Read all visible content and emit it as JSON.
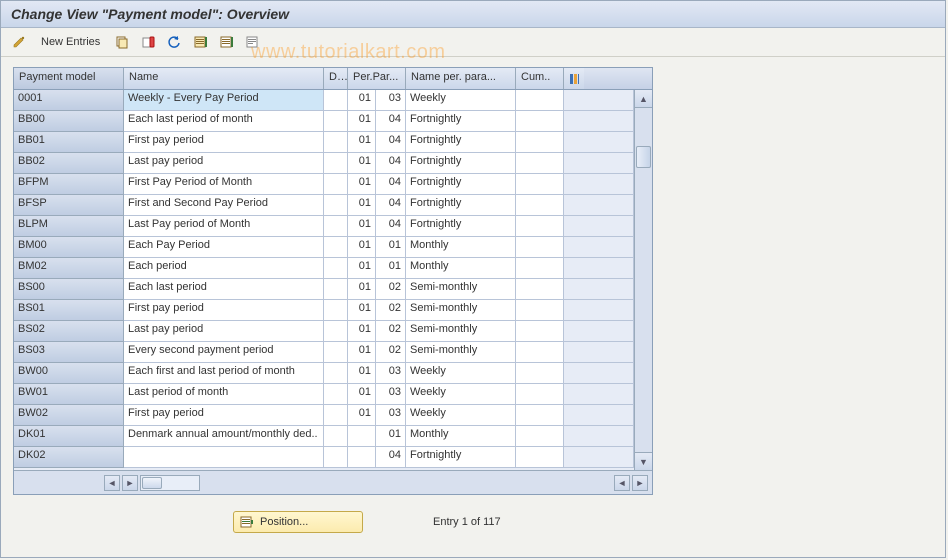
{
  "title": "Change View \"Payment model\": Overview",
  "toolbar": {
    "new_entries": "New Entries"
  },
  "watermark": "www.tutorialkart.com",
  "columns": {
    "c0": "Payment model",
    "c1": "Name",
    "c2": "D..",
    "c3": "Per.Par...",
    "c4": "Name per. para...",
    "c5": "Cum.."
  },
  "rows": [
    {
      "model": "0001",
      "name": "Weekly - Every Pay Period",
      "d": "",
      "pp": "01",
      "ppn": "03",
      "pname": "Weekly",
      "cum": "",
      "sel": true
    },
    {
      "model": "BB00",
      "name": "Each last period of month",
      "d": "",
      "pp": "01",
      "ppn": "04",
      "pname": "Fortnightly",
      "cum": ""
    },
    {
      "model": "BB01",
      "name": "First pay period",
      "d": "",
      "pp": "01",
      "ppn": "04",
      "pname": "Fortnightly",
      "cum": ""
    },
    {
      "model": "BB02",
      "name": "Last pay period",
      "d": "",
      "pp": "01",
      "ppn": "04",
      "pname": "Fortnightly",
      "cum": ""
    },
    {
      "model": "BFPM",
      "name": "First Pay Period of Month",
      "d": "",
      "pp": "01",
      "ppn": "04",
      "pname": "Fortnightly",
      "cum": ""
    },
    {
      "model": "BFSP",
      "name": "First and Second Pay Period",
      "d": "",
      "pp": "01",
      "ppn": "04",
      "pname": "Fortnightly",
      "cum": ""
    },
    {
      "model": "BLPM",
      "name": "Last Pay period of Month",
      "d": "",
      "pp": "01",
      "ppn": "04",
      "pname": "Fortnightly",
      "cum": ""
    },
    {
      "model": "BM00",
      "name": "Each Pay Period",
      "d": "",
      "pp": "01",
      "ppn": "01",
      "pname": "Monthly",
      "cum": ""
    },
    {
      "model": "BM02",
      "name": "Each period",
      "d": "",
      "pp": "01",
      "ppn": "01",
      "pname": "Monthly",
      "cum": ""
    },
    {
      "model": "BS00",
      "name": "Each last period",
      "d": "",
      "pp": "01",
      "ppn": "02",
      "pname": "Semi-monthly",
      "cum": ""
    },
    {
      "model": "BS01",
      "name": "First pay period",
      "d": "",
      "pp": "01",
      "ppn": "02",
      "pname": "Semi-monthly",
      "cum": ""
    },
    {
      "model": "BS02",
      "name": "Last pay period",
      "d": "",
      "pp": "01",
      "ppn": "02",
      "pname": "Semi-monthly",
      "cum": ""
    },
    {
      "model": "BS03",
      "name": "Every second payment period",
      "d": "",
      "pp": "01",
      "ppn": "02",
      "pname": "Semi-monthly",
      "cum": ""
    },
    {
      "model": "BW00",
      "name": "Each first and last period of month",
      "d": "",
      "pp": "01",
      "ppn": "03",
      "pname": "Weekly",
      "cum": ""
    },
    {
      "model": "BW01",
      "name": "Last period of month",
      "d": "",
      "pp": "01",
      "ppn": "03",
      "pname": "Weekly",
      "cum": ""
    },
    {
      "model": "BW02",
      "name": "First pay period",
      "d": "",
      "pp": "01",
      "ppn": "03",
      "pname": "Weekly",
      "cum": ""
    },
    {
      "model": "DK01",
      "name": "Denmark annual amount/monthly ded..",
      "d": "",
      "pp": "",
      "ppn": "01",
      "pname": "Monthly",
      "cum": ""
    },
    {
      "model": "DK02",
      "name": "",
      "d": "",
      "pp": "",
      "ppn": "04",
      "pname": "Fortnightly",
      "cum": ""
    }
  ],
  "position_btn": "Position...",
  "entry_text": "Entry 1 of 117"
}
